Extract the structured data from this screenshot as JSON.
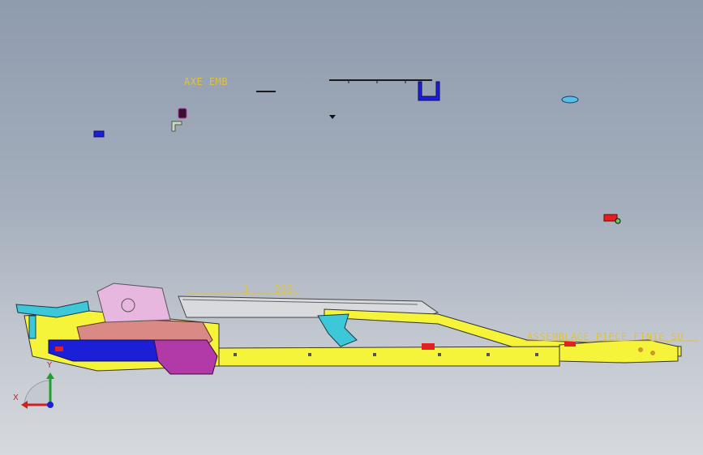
{
  "viewport": {
    "annotations": {
      "axe_emb": "AXE EMB",
      "dimension": "1____333",
      "assembly": "ASSEMBLAGE_PIECE_FINIE_SU"
    },
    "compass": {
      "x_label": "X",
      "y_label": "Y"
    }
  },
  "colors": {
    "background_top": "#8f9bae",
    "background_bottom": "#d6d9de",
    "frame_yellow": "#f6f43a",
    "annotation": "#e0c23a",
    "part_blue": "#1b1fd6",
    "part_magenta": "#b23aa8",
    "part_salmon": "#d98a84",
    "part_cyan": "#3cc8d8",
    "part_red": "#e22020"
  }
}
